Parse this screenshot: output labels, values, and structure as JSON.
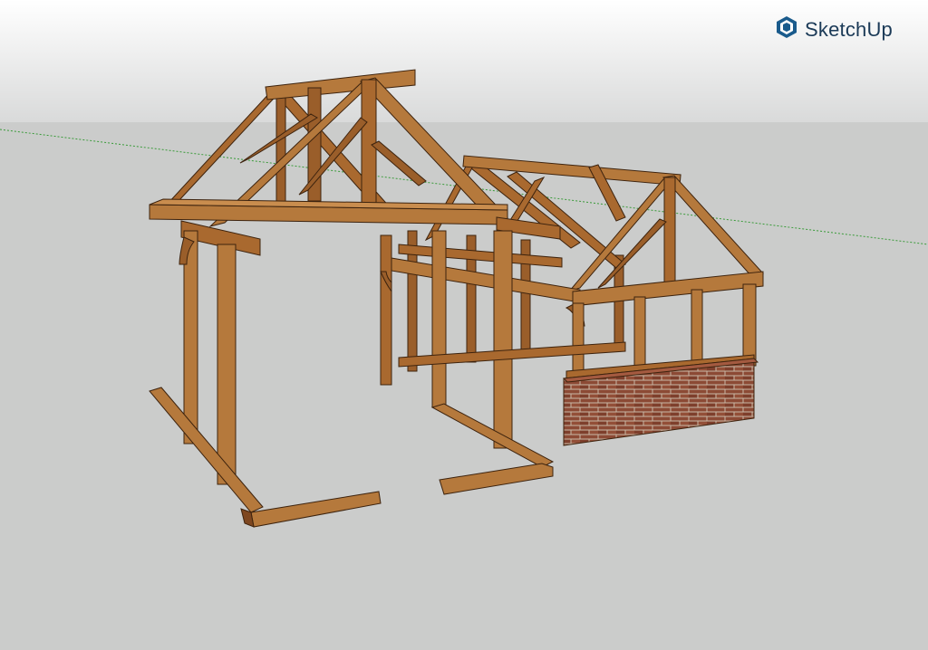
{
  "app": {
    "brand_name": "SketchUp",
    "brand_icon": "sketchup-logo-icon"
  },
  "scene": {
    "model": "oak-frame-structure",
    "colors": {
      "sky_top": "#ffffff",
      "sky_bottom": "#d9dada",
      "ground": "#cbcccb",
      "timber_light": "#b5793c",
      "timber_mid": "#9a5e2a",
      "timber_dark": "#6e3f1a",
      "brick": "#8c4a35",
      "mortar": "#c9b8a6",
      "green_axis": "#3a9b3a",
      "logo_blue": "#1a5b8c"
    }
  }
}
